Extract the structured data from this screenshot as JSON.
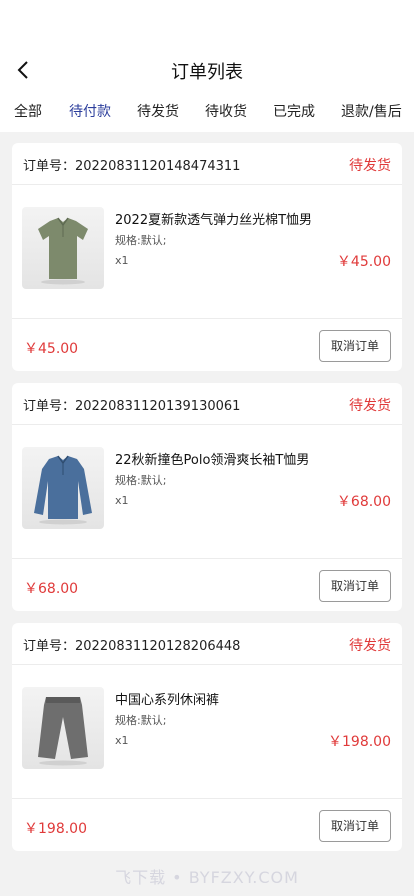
{
  "header": {
    "title": "订单列表",
    "back_icon": "chevron-left-icon"
  },
  "tabs": [
    {
      "label": "全部",
      "active": false
    },
    {
      "label": "待付款",
      "active": true
    },
    {
      "label": "待发货",
      "active": false
    },
    {
      "label": "待收货",
      "active": false
    },
    {
      "label": "已完成",
      "active": false
    },
    {
      "label": "退款/售后",
      "active": false
    }
  ],
  "orders": [
    {
      "order_label": "订单号：20220831120148474311",
      "status": "待发货",
      "product": {
        "name": "2022夏新款透气弹力丝光棉T恤男",
        "spec": "规格:默认;",
        "qty": "x1",
        "price": "￥45.00",
        "image": "green-polo-shirt"
      },
      "total": "￥45.00",
      "action": "取消订单"
    },
    {
      "order_label": "订单号：20220831120139130061",
      "status": "待发货",
      "product": {
        "name": "22秋新撞色Polo领滑爽长袖T恤男",
        "spec": "规格:默认;",
        "qty": "x1",
        "price": "￥68.00",
        "image": "blue-long-sleeve-polo"
      },
      "total": "￥68.00",
      "action": "取消订单"
    },
    {
      "order_label": "订单号：20220831120128206448",
      "status": "待发货",
      "product": {
        "name": "中国心系列休闲裤",
        "spec": "规格:默认;",
        "qty": "x1",
        "price": "￥198.00",
        "image": "grey-casual-pants"
      },
      "total": "￥198.00",
      "action": "取消订单"
    }
  ],
  "watermark": "飞下载 • BYFZXY.COM",
  "colors": {
    "accent_tab": "#2c3e9c",
    "price_red": "#e03a3a",
    "background": "#f2f2f2"
  }
}
